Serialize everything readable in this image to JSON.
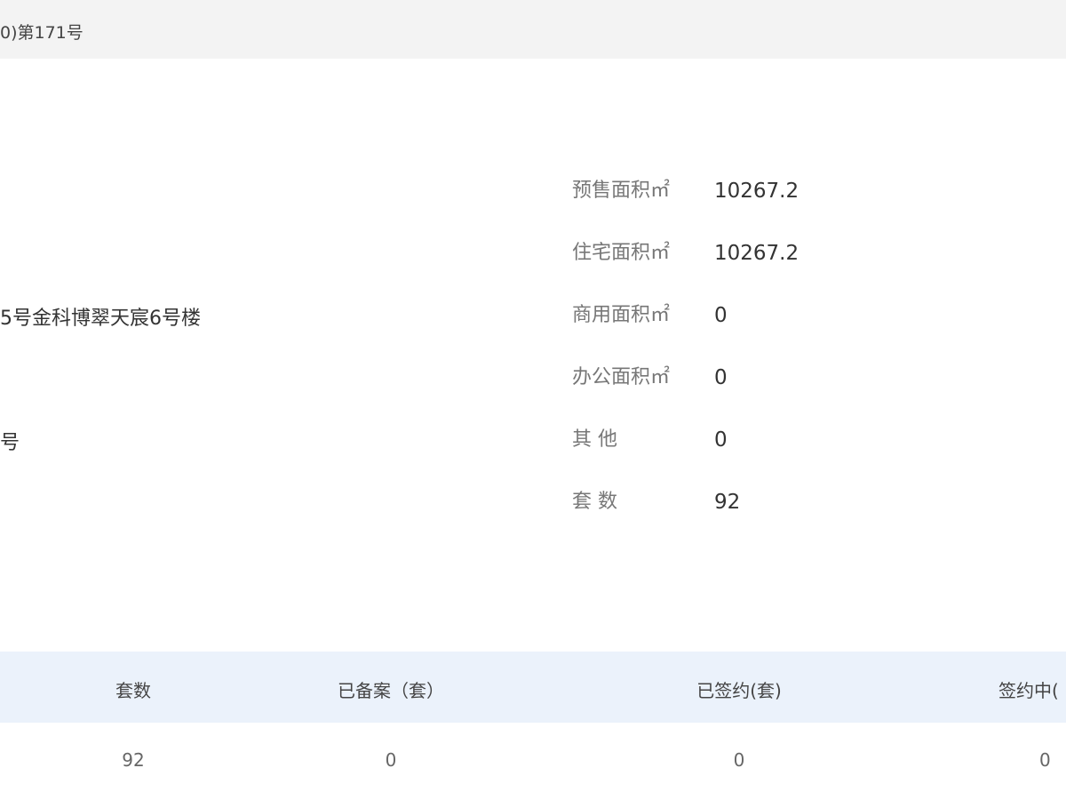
{
  "header": {
    "permit_fragment": "0)第171号"
  },
  "left": {
    "address_fragment": "5号金科博翠天宸6号楼",
    "number_fragment": "号"
  },
  "info": {
    "rows": [
      {
        "label": "预售面积㎡",
        "value": "10267.2"
      },
      {
        "label": "住宅面积㎡",
        "value": "10267.2"
      },
      {
        "label": "商用面积㎡",
        "value": "0"
      },
      {
        "label": "办公面积㎡",
        "value": "0"
      },
      {
        "label": "其 他",
        "value": "0"
      },
      {
        "label": "套 数",
        "value": "92"
      }
    ]
  },
  "table": {
    "headers": [
      "套数",
      "已备案（套）",
      "已签约(套)",
      "签约中("
    ],
    "row": [
      "92",
      "0",
      "0",
      "0"
    ]
  }
}
